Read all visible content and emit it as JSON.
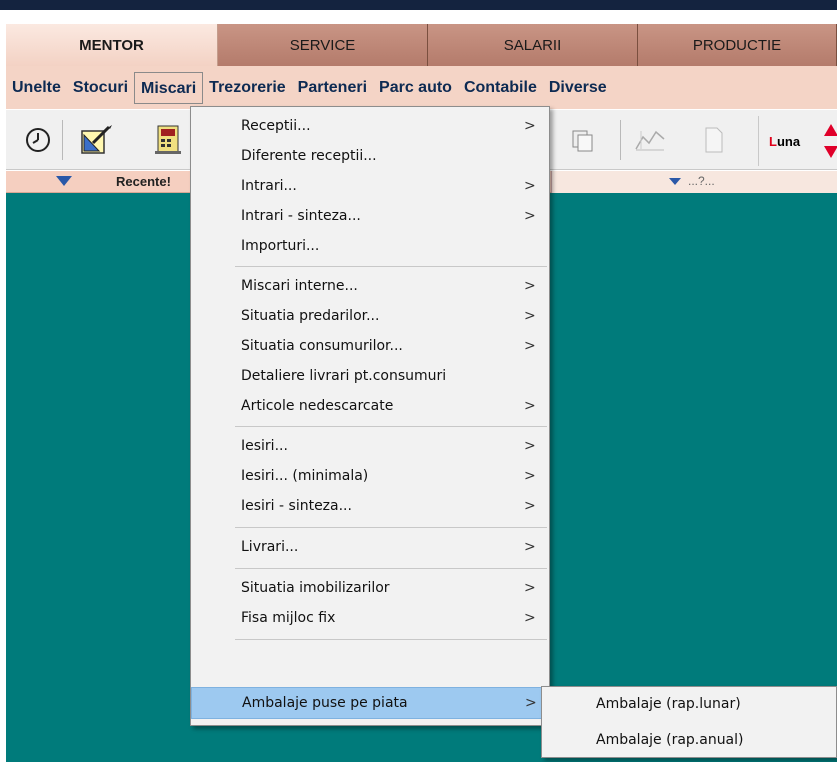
{
  "tabs": [
    "MENTOR",
    "SERVICE",
    "SALARII",
    "PRODUCTIE"
  ],
  "menubar": [
    "Unelte",
    "Stocuri",
    "Miscari",
    "Trezorerie",
    "Parteneri",
    "Parc auto",
    "Contabile",
    "Diverse"
  ],
  "toolbar": {
    "icons": [
      "clock-icon",
      "edit-document-icon",
      "calculator-icon",
      "copy-documents-icon",
      "chart-icon",
      "blank-page-icon"
    ],
    "luna_first": "L",
    "luna_rest": "una"
  },
  "strip": {
    "left_label": "Recente!",
    "right_label": "...?..."
  },
  "dropdown": {
    "items": [
      {
        "label": "Receptii...",
        "submenu": true
      },
      {
        "label": "Diferente receptii...",
        "submenu": false
      },
      {
        "label": "Intrari...",
        "submenu": true
      },
      {
        "label": "Intrari - sinteza...",
        "submenu": true
      },
      {
        "label": "Importuri...",
        "submenu": false
      },
      {
        "label": "Miscari interne...",
        "submenu": true
      },
      {
        "label": "Situatia predarilor...",
        "submenu": true
      },
      {
        "label": "Situatia consumurilor...",
        "submenu": true
      },
      {
        "label": "Detaliere livrari pt.consumuri",
        "submenu": false
      },
      {
        "label": "Articole nedescarcate",
        "submenu": true
      },
      {
        "label": "Iesiri...",
        "submenu": true
      },
      {
        "label": "Iesiri... (minimala)",
        "submenu": true
      },
      {
        "label": "Iesiri - sinteza...",
        "submenu": true
      },
      {
        "label": "Livrari...",
        "submenu": true
      },
      {
        "label": "Situatia imobilizarilor",
        "submenu": true
      },
      {
        "label": "Fisa mijloc fix",
        "submenu": true
      },
      {
        "label": "Ambalaje puse pe piata",
        "submenu": true
      }
    ],
    "highlighted": "Ambalaje puse pe piata",
    "arrow": ">"
  },
  "submenu": {
    "items": [
      "Ambalaje (rap.lunar)",
      "Ambalaje (rap.anual)"
    ]
  },
  "colors": {
    "workspace": "#007b7b",
    "menubar": "#f4d4c6",
    "highlight": "#9dc9f0"
  }
}
